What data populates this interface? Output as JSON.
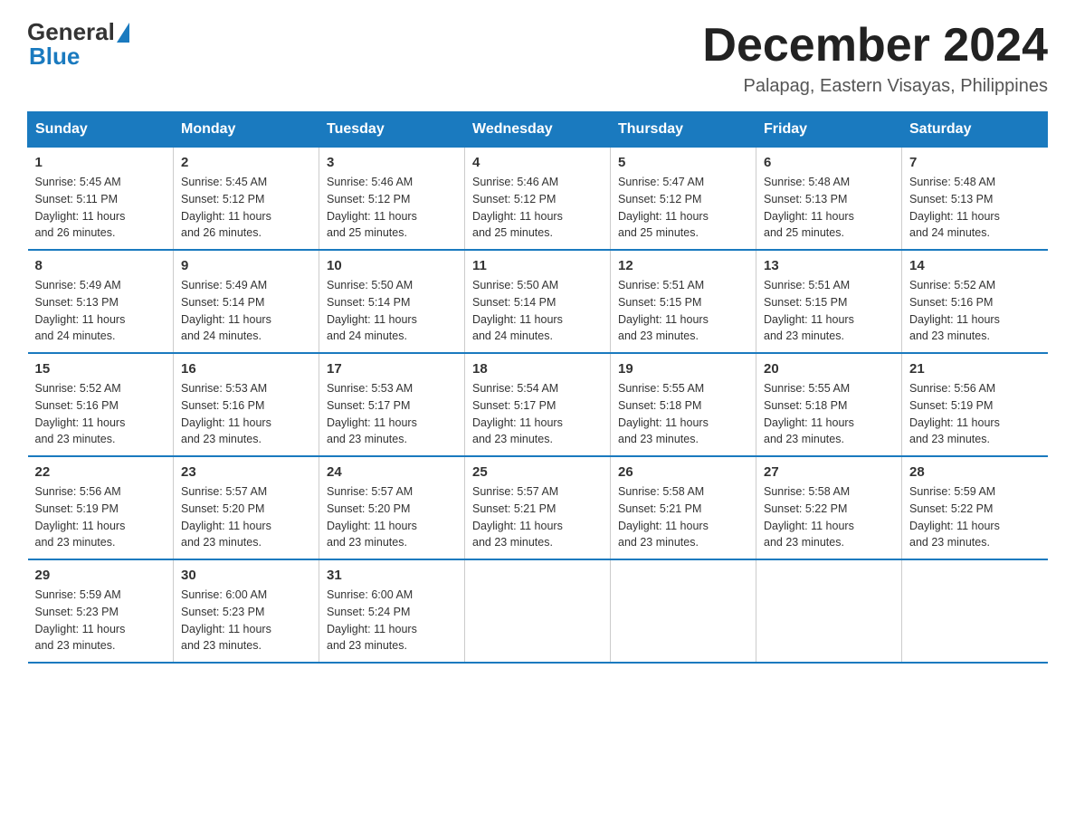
{
  "header": {
    "logo_general": "General",
    "logo_blue": "Blue",
    "title": "December 2024",
    "subtitle": "Palapag, Eastern Visayas, Philippines"
  },
  "days_of_week": [
    "Sunday",
    "Monday",
    "Tuesday",
    "Wednesday",
    "Thursday",
    "Friday",
    "Saturday"
  ],
  "weeks": [
    [
      {
        "num": "1",
        "rise": "5:45 AM",
        "set": "5:11 PM",
        "daylight": "11 hours and 26 minutes."
      },
      {
        "num": "2",
        "rise": "5:45 AM",
        "set": "5:12 PM",
        "daylight": "11 hours and 26 minutes."
      },
      {
        "num": "3",
        "rise": "5:46 AM",
        "set": "5:12 PM",
        "daylight": "11 hours and 25 minutes."
      },
      {
        "num": "4",
        "rise": "5:46 AM",
        "set": "5:12 PM",
        "daylight": "11 hours and 25 minutes."
      },
      {
        "num": "5",
        "rise": "5:47 AM",
        "set": "5:12 PM",
        "daylight": "11 hours and 25 minutes."
      },
      {
        "num": "6",
        "rise": "5:48 AM",
        "set": "5:13 PM",
        "daylight": "11 hours and 25 minutes."
      },
      {
        "num": "7",
        "rise": "5:48 AM",
        "set": "5:13 PM",
        "daylight": "11 hours and 24 minutes."
      }
    ],
    [
      {
        "num": "8",
        "rise": "5:49 AM",
        "set": "5:13 PM",
        "daylight": "11 hours and 24 minutes."
      },
      {
        "num": "9",
        "rise": "5:49 AM",
        "set": "5:14 PM",
        "daylight": "11 hours and 24 minutes."
      },
      {
        "num": "10",
        "rise": "5:50 AM",
        "set": "5:14 PM",
        "daylight": "11 hours and 24 minutes."
      },
      {
        "num": "11",
        "rise": "5:50 AM",
        "set": "5:14 PM",
        "daylight": "11 hours and 24 minutes."
      },
      {
        "num": "12",
        "rise": "5:51 AM",
        "set": "5:15 PM",
        "daylight": "11 hours and 23 minutes."
      },
      {
        "num": "13",
        "rise": "5:51 AM",
        "set": "5:15 PM",
        "daylight": "11 hours and 23 minutes."
      },
      {
        "num": "14",
        "rise": "5:52 AM",
        "set": "5:16 PM",
        "daylight": "11 hours and 23 minutes."
      }
    ],
    [
      {
        "num": "15",
        "rise": "5:52 AM",
        "set": "5:16 PM",
        "daylight": "11 hours and 23 minutes."
      },
      {
        "num": "16",
        "rise": "5:53 AM",
        "set": "5:16 PM",
        "daylight": "11 hours and 23 minutes."
      },
      {
        "num": "17",
        "rise": "5:53 AM",
        "set": "5:17 PM",
        "daylight": "11 hours and 23 minutes."
      },
      {
        "num": "18",
        "rise": "5:54 AM",
        "set": "5:17 PM",
        "daylight": "11 hours and 23 minutes."
      },
      {
        "num": "19",
        "rise": "5:55 AM",
        "set": "5:18 PM",
        "daylight": "11 hours and 23 minutes."
      },
      {
        "num": "20",
        "rise": "5:55 AM",
        "set": "5:18 PM",
        "daylight": "11 hours and 23 minutes."
      },
      {
        "num": "21",
        "rise": "5:56 AM",
        "set": "5:19 PM",
        "daylight": "11 hours and 23 minutes."
      }
    ],
    [
      {
        "num": "22",
        "rise": "5:56 AM",
        "set": "5:19 PM",
        "daylight": "11 hours and 23 minutes."
      },
      {
        "num": "23",
        "rise": "5:57 AM",
        "set": "5:20 PM",
        "daylight": "11 hours and 23 minutes."
      },
      {
        "num": "24",
        "rise": "5:57 AM",
        "set": "5:20 PM",
        "daylight": "11 hours and 23 minutes."
      },
      {
        "num": "25",
        "rise": "5:57 AM",
        "set": "5:21 PM",
        "daylight": "11 hours and 23 minutes."
      },
      {
        "num": "26",
        "rise": "5:58 AM",
        "set": "5:21 PM",
        "daylight": "11 hours and 23 minutes."
      },
      {
        "num": "27",
        "rise": "5:58 AM",
        "set": "5:22 PM",
        "daylight": "11 hours and 23 minutes."
      },
      {
        "num": "28",
        "rise": "5:59 AM",
        "set": "5:22 PM",
        "daylight": "11 hours and 23 minutes."
      }
    ],
    [
      {
        "num": "29",
        "rise": "5:59 AM",
        "set": "5:23 PM",
        "daylight": "11 hours and 23 minutes."
      },
      {
        "num": "30",
        "rise": "6:00 AM",
        "set": "5:23 PM",
        "daylight": "11 hours and 23 minutes."
      },
      {
        "num": "31",
        "rise": "6:00 AM",
        "set": "5:24 PM",
        "daylight": "11 hours and 23 minutes."
      },
      null,
      null,
      null,
      null
    ]
  ],
  "labels": {
    "sunrise": "Sunrise:",
    "sunset": "Sunset:",
    "daylight": "Daylight:"
  }
}
